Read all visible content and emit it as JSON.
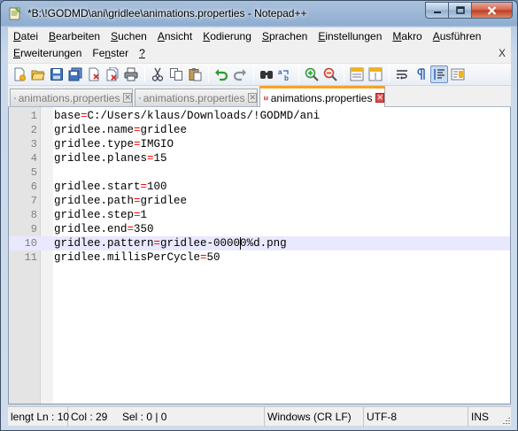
{
  "window": {
    "title": "*B:\\!GODMD\\ani\\gridlee\\animations.properties - Notepad++"
  },
  "menu": {
    "row1": [
      {
        "acc": "D",
        "rest": "atei"
      },
      {
        "acc": "B",
        "rest": "earbeiten"
      },
      {
        "acc": "S",
        "rest": "uchen"
      },
      {
        "acc": "A",
        "rest": "nsicht"
      },
      {
        "acc": "K",
        "rest": "odierung"
      },
      {
        "acc": "S",
        "rest": "prachen"
      },
      {
        "acc": "E",
        "rest": "instellungen"
      },
      {
        "acc": "M",
        "rest": "akro"
      },
      {
        "acc": "A",
        "rest": "usführen"
      }
    ],
    "row2": [
      {
        "acc": "E",
        "rest": "rweiterungen"
      },
      {
        "pre": "Fe",
        "acc": "n",
        "rest": "ster"
      },
      {
        "acc": "?",
        "rest": ""
      }
    ],
    "close_doc": "X"
  },
  "tabs": [
    {
      "label": "animations.properties",
      "active": false,
      "saved": true
    },
    {
      "label": "animations.properties",
      "active": false,
      "saved": true
    },
    {
      "label": "animations.properties",
      "active": true,
      "saved": false
    }
  ],
  "editor": {
    "current_line": 10,
    "caret_column": 29,
    "lines": [
      {
        "n": "1",
        "key": "base",
        "value": "C:/Users/klaus/Downloads/!GODMD/ani"
      },
      {
        "n": "2",
        "key": "gridlee.name",
        "value": "gridlee"
      },
      {
        "n": "3",
        "key": "gridlee.type",
        "value": "IMGIO"
      },
      {
        "n": "4",
        "key": "gridlee.planes",
        "value": "15"
      },
      {
        "n": "5",
        "key": "",
        "value": ""
      },
      {
        "n": "6",
        "key": "gridlee.start",
        "value": "100"
      },
      {
        "n": "7",
        "key": "gridlee.path",
        "value": "gridlee"
      },
      {
        "n": "8",
        "key": "gridlee.step",
        "value": "1"
      },
      {
        "n": "9",
        "key": "gridlee.end",
        "value": "350"
      },
      {
        "n": "10",
        "key": "gridlee.pattern",
        "value": "gridlee-00000%d.png"
      },
      {
        "n": "11",
        "key": "gridlee.millisPerCycle",
        "value": "50"
      }
    ]
  },
  "status": {
    "length": "lengt",
    "ln": "Ln : 10",
    "col": "Col : 29",
    "sel": "Sel : 0 | 0",
    "eol": "Windows (CR LF)",
    "encoding": "UTF-8",
    "mode": "INS"
  },
  "colors": {
    "accent_tab": "#f6a325",
    "current_line": "#e8e8ff",
    "operator": "#ff0000"
  },
  "toolbar_icons": [
    "new-file-icon",
    "open-file-icon",
    "save-icon",
    "save-all-icon",
    "close-icon",
    "close-all-icon",
    "print-icon",
    "cut-icon",
    "copy-icon",
    "paste-icon",
    "undo-icon",
    "redo-icon",
    "find-icon",
    "replace-icon",
    "zoom-in-icon",
    "zoom-out-icon",
    "sync-vertical-icon",
    "sync-horizontal-icon",
    "word-wrap-icon",
    "show-all-chars-icon",
    "indent-guide-icon",
    "document-map-icon"
  ]
}
